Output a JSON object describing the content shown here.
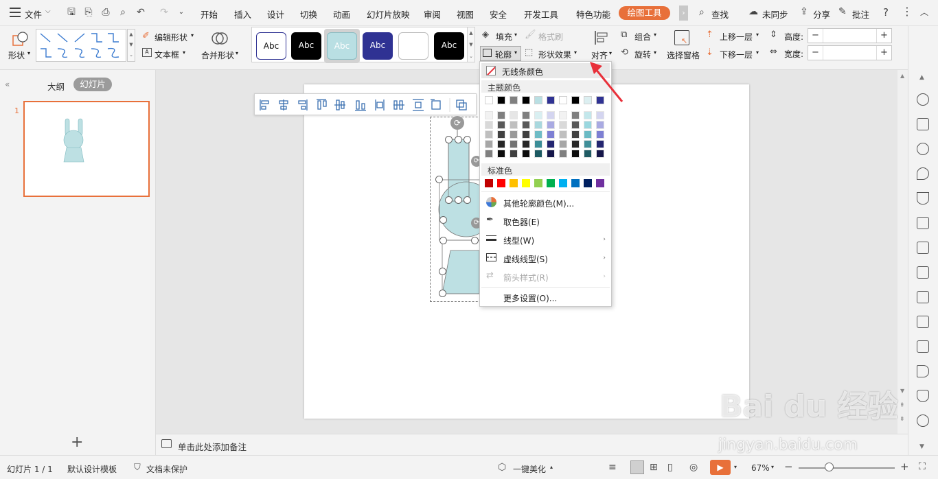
{
  "topbar": {
    "file_label": "文件",
    "tabs": [
      "开始",
      "插入",
      "设计",
      "切换",
      "动画",
      "幻灯片放映",
      "审阅",
      "视图",
      "安全",
      "开发工具",
      "特色功能"
    ],
    "active_tab": "绘图工具",
    "search_label": "查找",
    "sync_label": "未同步",
    "share_label": "分享",
    "comment_label": "批注",
    "help_icon": "?"
  },
  "ribbon": {
    "shape_label": "形状",
    "edit_shape_label": "编辑形状",
    "textbox_label": "文本框",
    "merge_shape_label": "合并形状",
    "style_samples": [
      "Abc",
      "Abc",
      "Abc",
      "Abc",
      "",
      "Abc"
    ],
    "fill_label": "填充",
    "format_painter_label": "格式刷",
    "outline_label": "轮廓",
    "shape_effect_label": "形状效果",
    "align_label": "对齐",
    "group_label": "组合",
    "rotate_label": "旋转",
    "selection_pane_label": "选择窗格",
    "bring_forward_label": "上移一层",
    "send_backward_label": "下移一层",
    "height_label": "高度:",
    "width_label": "宽度:",
    "minus": "−",
    "plus": "+"
  },
  "left_panel": {
    "outline_tab": "大纲",
    "slides_tab": "幻灯片",
    "slide_number": "1",
    "add_icon": "+"
  },
  "notes": {
    "placeholder": "单击此处添加备注"
  },
  "outline_menu": {
    "no_line": "无线条颜色",
    "theme_colors_label": "主题颜色",
    "theme_top_row": [
      "#ffffff",
      "#000000",
      "#808080",
      "#000000",
      "#b9dfe3",
      "#2f3293",
      "#ffffff",
      "#000000",
      "#dceff1",
      "#2f3293"
    ],
    "shade_columns": [
      [
        "#f2f2f2",
        "#d9d9d9",
        "#bfbfbf",
        "#a6a6a6",
        "#808080"
      ],
      [
        "#7f7f7f",
        "#595959",
        "#404040",
        "#262626",
        "#0d0d0d"
      ],
      [
        "#e6e6e6",
        "#bfbfbf",
        "#999999",
        "#737373",
        "#404040"
      ],
      [
        "#7f7f7f",
        "#595959",
        "#404040",
        "#262626",
        "#0d0d0d"
      ],
      [
        "#d9eff1",
        "#a9d8de",
        "#6fbcc6",
        "#3b8d97",
        "#1c5a62"
      ],
      [
        "#d4d5f0",
        "#a9aae2",
        "#7d7fd3",
        "#232570",
        "#16174a"
      ],
      [
        "#f2f2f2",
        "#d9d9d9",
        "#bfbfbf",
        "#a6a6a6",
        "#808080"
      ],
      [
        "#7f7f7f",
        "#595959",
        "#404040",
        "#262626",
        "#0d0d0d"
      ],
      [
        "#c3e7eb",
        "#9ad7df",
        "#6bbac4",
        "#3f8e98",
        "#1f5b63"
      ],
      [
        "#d4d5f0",
        "#a9aae2",
        "#7d7fd3",
        "#232570",
        "#16174a"
      ]
    ],
    "standard_colors_label": "标准色",
    "standard_colors": [
      "#c00000",
      "#ff0000",
      "#ffc000",
      "#ffff00",
      "#92d050",
      "#00b050",
      "#00b0f0",
      "#0070c0",
      "#002060",
      "#7030a0"
    ],
    "more_colors": "其他轮廓颜色(M)...",
    "eyedropper": "取色器(E)",
    "line_type": "线型(W)",
    "dash_type": "虚线线型(S)",
    "arrow_style": "箭头样式(R)",
    "more_settings": "更多设置(O)..."
  },
  "status": {
    "slide_info": "幻灯片 1 / 1",
    "template": "默认设计模板",
    "protection": "文档未保护",
    "beautify": "一键美化",
    "zoom": "67%"
  },
  "watermark": {
    "brand": "Bai du 经验",
    "url": "jingyan.baidu.com"
  },
  "colors": {
    "accent_orange": "#e8703a",
    "shape_fill": "#bde0e3",
    "arrow_red": "#e8303a"
  }
}
